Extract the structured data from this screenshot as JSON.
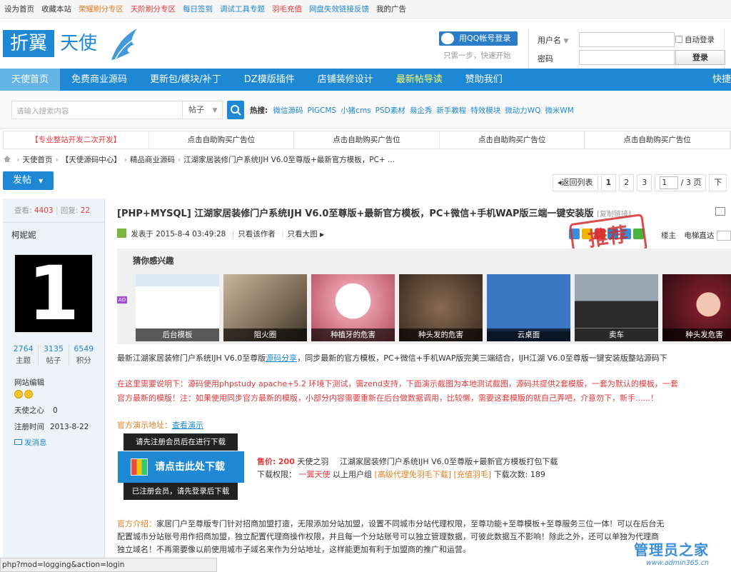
{
  "topbar": {
    "links": [
      {
        "label": "设为首页",
        "color": "#333333"
      },
      {
        "label": "收藏本站",
        "color": "#333333"
      },
      {
        "label": "荣耀刷分专区",
        "color": "#e67e22"
      },
      {
        "label": "天阶刷分专区",
        "color": "#e4393c"
      },
      {
        "label": "每日签到",
        "color": "#1e88d4"
      },
      {
        "label": "调试工具专题",
        "color": "#1e88d4"
      },
      {
        "label": "羽毛充值",
        "color": "#e4393c"
      },
      {
        "label": "网盘失效链接反馈",
        "color": "#1e88d4"
      },
      {
        "label": "我的广告",
        "color": "#333333"
      }
    ]
  },
  "logo": {
    "part1": "折翼",
    "part2": "天使"
  },
  "qq_login": {
    "label": "用QQ帐号登录",
    "hint": "只需一步，快速开始"
  },
  "login": {
    "username_label": "用户名",
    "password_label": "密码",
    "auto_login": "自动登录",
    "login_button": "登录"
  },
  "nav": {
    "items": [
      {
        "label": "天使首页",
        "active": true
      },
      {
        "label": "免费商业源码"
      },
      {
        "label": "更新包/模块/补丁"
      },
      {
        "label": "DZ模版插件"
      },
      {
        "label": "店铺装修设计"
      },
      {
        "label": "最新帖导读",
        "highlight": true
      },
      {
        "label": "赞助我们"
      },
      {
        "label": "快捷"
      }
    ]
  },
  "search": {
    "placeholder": "请输入搜索内容",
    "type": "帖子",
    "hot_label": "热搜:",
    "hot_words": [
      "微信源码",
      "PIGCMS",
      "小猪cms",
      "PSD素材",
      "易企秀",
      "新手教程",
      "特效模块",
      "微动力WQ",
      "微米WM"
    ]
  },
  "adbar": {
    "slots": [
      "【专业整站开发二次开发】",
      "点击自助购买广告位",
      "点击自助购买广告位",
      "点击自助购买广告位",
      "点击自助购买广告位"
    ]
  },
  "breadcrumb": [
    "天使首页",
    "【天使源码中心】",
    "精品商业源码",
    "江湖家居装修门户系统IJH V6.0至尊版+最新官方模板，PC+ ..."
  ],
  "post_button": "发帖",
  "pager": {
    "back": "返回列表",
    "pages": [
      "1",
      "2",
      "3"
    ],
    "current": "1",
    "total": "/ 3 页",
    "next": "下"
  },
  "thread": {
    "views_label": "查看:",
    "views": "4403",
    "replies_label": "回复:",
    "replies": "22"
  },
  "author": {
    "name": "柯妮妮",
    "avatar_text": "1",
    "stats": [
      {
        "value": "2764",
        "label": "主题"
      },
      {
        "value": "3135",
        "label": "帖子"
      },
      {
        "value": "6549",
        "label": "积分"
      }
    ],
    "role": "网站编辑",
    "coins_label": "天使之心",
    "coins": "0",
    "reg_label": "注册时间",
    "reg_date": "2013-8-22",
    "send_message": "发消息"
  },
  "post": {
    "title": "[PHP+MYSQL] 江湖家居装修门户系统IJH V6.0至尊版+最新官方模板，PC+微信+手机WAP版三端一键安装版",
    "copy_link": "[复制链接]",
    "posted_label": "发表于",
    "posted_time": "2015-8-4 03:49:28",
    "only_author": "只看该作者",
    "only_big": "只看大图",
    "stamp": "推荐",
    "floor": "楼主",
    "jump_label": "电梯直达",
    "recommend_title": "猜你感兴趣",
    "recommend_badge": "AD",
    "thumbs": [
      "后台模板",
      "阻火圈",
      "种植牙的危害",
      "种头发的危害",
      "云桌面",
      "卖车",
      "种头发危害"
    ],
    "intro_line_a": "最新江湖家居装修门户系统IJH V6.0至尊版",
    "intro_line_link": "源码分享",
    "intro_line_b": "，同步最新的官方模板，PC+微信+手机WAP版完美三端结合，IJH江湖 V6.0至尊版一键安装版整站源码下",
    "note_line1": "在这里需要说明下：源码使用phpstudy apache+5.2 环境下测试，需zend支持，下面演示截图为本地测试截图，源码共提供2套模版，一套为默认的模板，一套",
    "note_line2": "官方最新的模版！注：如果使用同步官方最新的模版，小部分内容需要重新在后台做数据调用，比较懒，需要这套模版的就自己弄吧，介意勿下，新手......！",
    "demo_label": "官方演示地址：",
    "demo_link": "查看演示"
  },
  "download": {
    "tip_top": "请先注册会员后在进行下载",
    "button": "请点击此处下载",
    "tip_bottom": "已注册会员，请先登录后下载",
    "price_label": "售价:",
    "price": "200",
    "currency": "天使之羽",
    "file_name": "江湖家居装修门户系统IJH V6.0至尊版+最新官方模板打包下载",
    "perm_label": "下载权限：",
    "perm_group": "一翼天使",
    "perm_suffix": "以上用户组",
    "perm_link1": "[高级代理免羽毛下载]",
    "perm_link2": "[充值羽毛]",
    "count_label": "下载次数:",
    "count": "189"
  },
  "intro": {
    "label": "官方介绍：",
    "line1": "家居门户至尊版专门针对招商加盟打造，无限添加分站加盟，设置不同城市分站代理权限，至尊功能+至尊模板+至尊服务三位一体！可以在后台无",
    "line2": "配置城市分站账号用作招商加盟，独立配置代理商操作权限，并且每一个分站账号可以独立管理数据，可彼此数据互不影响！除此之外，还可以单独为代理商",
    "line3": "独立域名！不再需要像以前使用城市子域名来作为分站地址，这样能更加有利于加盟商的推广和运营。"
  },
  "statusbar": "php?mod=logging&action=login",
  "watermark": {
    "title": "管理员之家",
    "url": "www.admin365.cn"
  }
}
